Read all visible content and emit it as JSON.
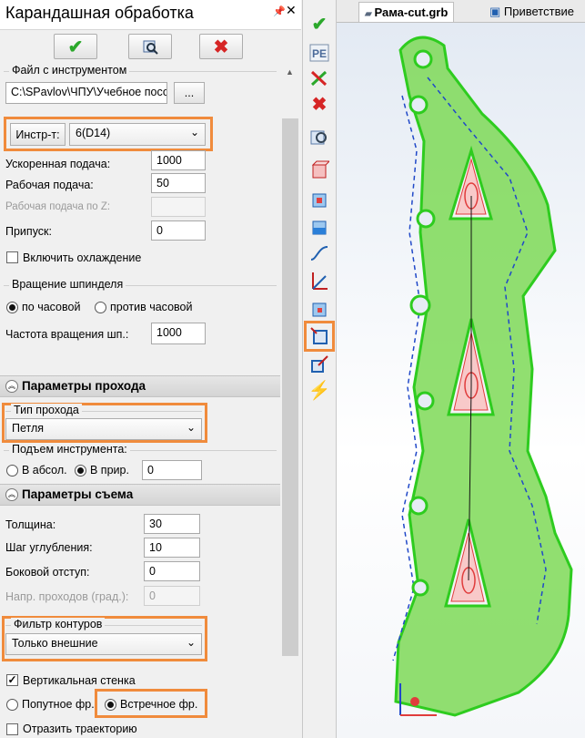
{
  "panel": {
    "title": "Карандашная обработка",
    "pin": "ᵖ",
    "close": "✕",
    "ok_glyph": "✔",
    "cancel_glyph": "✖"
  },
  "tool_file": {
    "group_label": "Файл с инструментом",
    "path": "C:\\SPavlov\\ЧПУ\\Учебное посо",
    "browse_label": "..."
  },
  "tool": {
    "button_label": "Инстр-т:",
    "value": "6(D14)"
  },
  "params": {
    "rapid_label": "Ускоренная подача:",
    "rapid_value": "1000",
    "feed_label": "Рабочая подача:",
    "feed_value": "50",
    "feed_z_label": "Рабочая подача по Z:",
    "allowance_label": "Припуск:",
    "allowance_value": "0",
    "coolant_label": "Включить охлаждение"
  },
  "spindle": {
    "group_label": "Вращение шпинделя",
    "cw_label": "по часовой",
    "ccw_label": "против часовой",
    "speed_label": "Частота вращения шп.:",
    "speed_value": "1000"
  },
  "pass_section": {
    "title": "Параметры прохода",
    "type_group": "Тип прохода",
    "type_value": "Петля",
    "lift_group": "Подъем инструмента:",
    "abs_label": "В абсол.",
    "rel_label": "В прир.",
    "lift_value": "0"
  },
  "removal_section": {
    "title": "Параметры съема",
    "thickness_label": "Толщина:",
    "thickness_value": "30",
    "step_label": "Шаг углубления:",
    "step_value": "10",
    "side_label": "Боковой отступ:",
    "side_value": "0",
    "angle_label": "Напр. проходов (град.):",
    "angle_value": "0",
    "filter_group": "Фильтр контуров",
    "filter_value": "Только внешние",
    "vertical_label": "Вертикальная стенка",
    "climb_label": "Попутное фр.",
    "conv_label": "Встречное фр.",
    "mirror_label": "Отразить траекторию"
  },
  "tabs": {
    "active": "Рама-cut.grb",
    "other": "Приветствие"
  },
  "colors": {
    "highlight": "#f08b3c",
    "part_fill": "#7ed957",
    "part_edge": "#2ecc1f"
  },
  "vtoolbar_icons": [
    "check-icon",
    "pe-icon",
    "cycle-icon",
    "delete-icon",
    "view-icon",
    "box-red-icon",
    "box-blue-icon",
    "box-blue2-icon",
    "curve-icon",
    "axis-icon",
    "box-cut-icon",
    "pencil-machining-icon",
    "box-arrow-icon",
    "lightning-icon"
  ]
}
